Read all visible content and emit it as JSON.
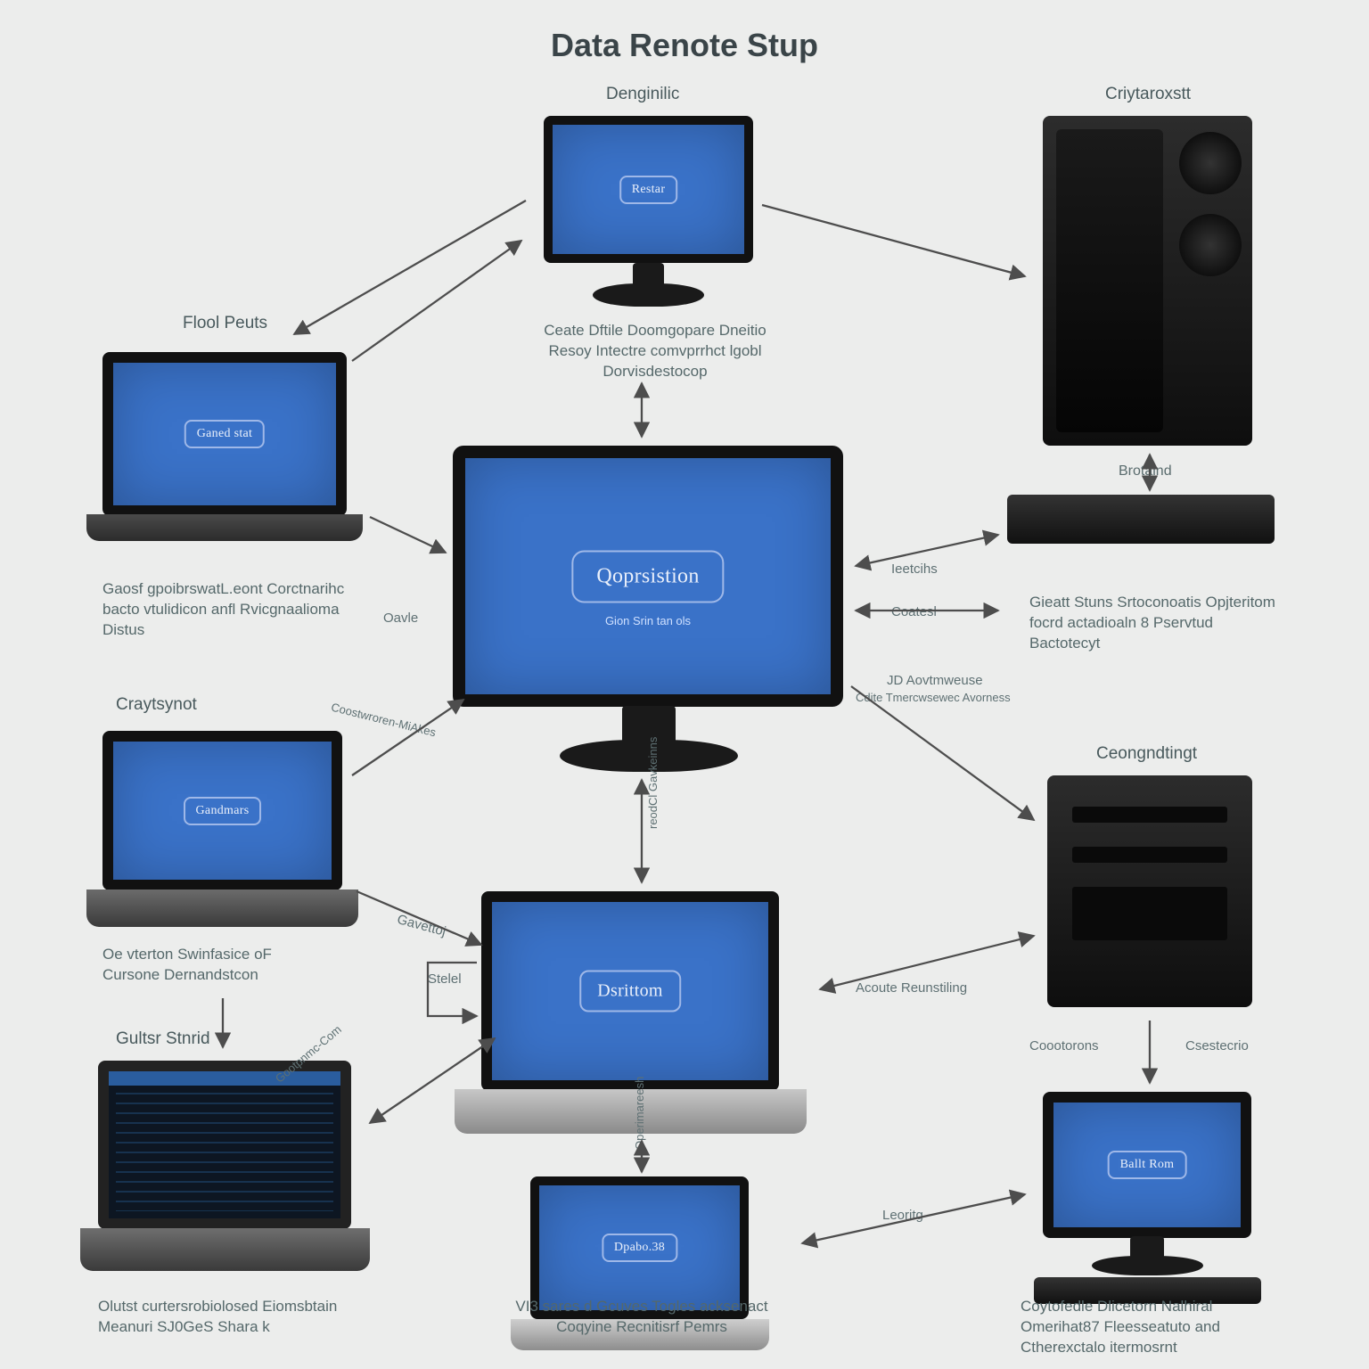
{
  "title": "Data Renote Stup",
  "nodes": {
    "top_monitor": {
      "label": "Denginilic",
      "badge": "Restar",
      "desc": "Ceate Dftile Doomgopare Dneitio Resoy Intectre comvprrhct lgobl Dorvisdestocop"
    },
    "left_laptop1": {
      "label": "Flool Peuts",
      "badge": "Ganed stat",
      "desc": "Gaosf gpoibrswatL.eont Corctnarihc bacto vtulidicon anfl Rvicgnaalioma Distus"
    },
    "center_monitor": {
      "badge": "Qoprsistion",
      "sub": "Gion Srin tan ols"
    },
    "right_tower": {
      "label": "Criytaroxstt",
      "sub": "Brotaind",
      "desc": "Gieatt Stuns Srtoconoatis Opjteritom focrd actadioaln 8 Pservtud Bactotecyt"
    },
    "left_laptop2": {
      "label": "Craytsynot",
      "badge": "Gandmars",
      "desc": "Oe vterton Swinfasice oF Cursone Dernandstcon"
    },
    "small_tower": {
      "label": "Ceongndtingt"
    },
    "left_laptop3": {
      "label": "Gultsr Stnrid",
      "desc": "Olutst curtersrobiolosed Eiomsbtain Meanuri SJ0GeS Shara k"
    },
    "bottom_laptop": {
      "badge": "Dsrittom",
      "desc": "VI3 sares d Gcuves Togles acksenact Coqyine Recnitisrf Pemrs"
    },
    "br_laptop": {
      "badge": "Dpabo.38"
    },
    "br_desktop": {
      "badge": "Ballt Rom",
      "desc": "Coytofedle Dlicetorn Nalhiral Omerihat87 Fleesseatuto and Ctherexctalo itermosrnt"
    }
  },
  "edges": {
    "oavle": "Oavle",
    "ieetcihs": "Ieetcihs",
    "coatesl": "Coatesl",
    "stelel": "Stelel",
    "gavettoj": "Gavettoj",
    "acoute": "Acoute Reunstiling",
    "leoritg": "Leoritg",
    "coootorons": "Coootorons",
    "csestecrio": "Csestecrio",
    "coost": "Coostwroren-MiAkes",
    "operim": "Operimareesh",
    "reodcl": "reodCl Gavkeinns",
    "jd_aovtm": "JD Aovtmweuse",
    "cdite": "Cdite Tmercwsewec Avorness",
    "goot": "Gootpnmc-Com"
  }
}
